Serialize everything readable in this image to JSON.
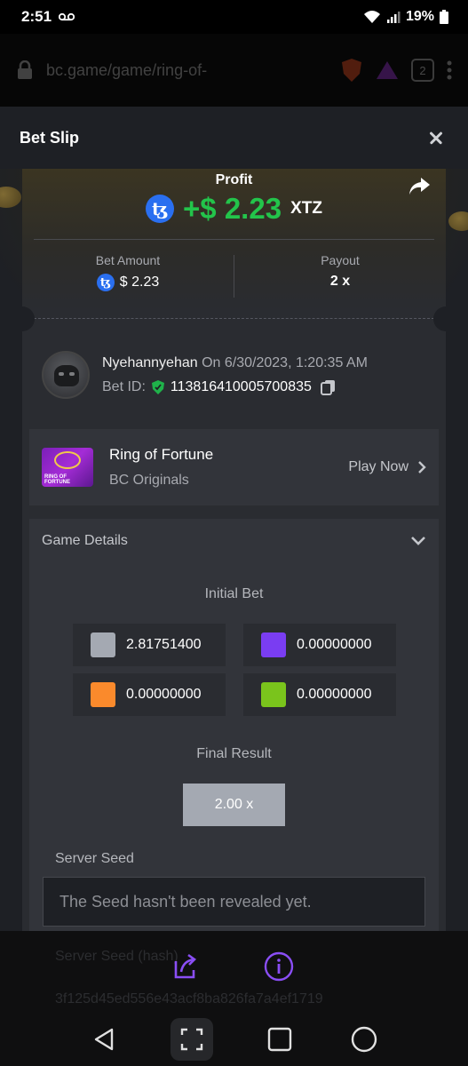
{
  "status_bar": {
    "time": "2:51",
    "battery": "19%"
  },
  "browser": {
    "url": "bc.game/game/ring-of-",
    "tab_count": "2"
  },
  "sheet": {
    "title": "Bet Slip",
    "profit_label": "Profit",
    "profit_value": "+$ 2.23",
    "profit_currency": "XTZ",
    "bet_amount_label": "Bet Amount",
    "bet_amount_value": "$ 2.23",
    "payout_label": "Payout",
    "payout_value": "2 x",
    "user": {
      "name": "Nyehannyehan",
      "date_text": "On 6/30/2023, 1:20:35 AM",
      "bet_id_label": "Bet ID:",
      "bet_id": "113816410005700835"
    },
    "game": {
      "name": "Ring of Fortune",
      "provider": "BC Originals",
      "play_now": "Play Now",
      "thumb_text": "RING OF FORTUNE",
      "thumb_badge": "BC.GAME"
    },
    "details": {
      "title": "Game Details",
      "initial_bet_label": "Initial Bet",
      "bets": [
        {
          "color": "#a4a9b2",
          "value": "2.81751400"
        },
        {
          "color": "#7a3df2",
          "value": "0.00000000"
        },
        {
          "color": "#fa8a2c",
          "value": "0.00000000"
        },
        {
          "color": "#7ac41c",
          "value": "0.00000000"
        }
      ],
      "final_result_label": "Final Result",
      "final_result_value": "2.00 x",
      "server_seed_label": "Server Seed",
      "server_seed_value": "The Seed hasn't been revealed yet."
    }
  },
  "bottom_overlay": {
    "bg_label": "Server Seed (hash)",
    "bg_hash": "3f125d45ed556e43acf8ba826fa7a4ef1719"
  },
  "colors": {
    "accent_purple": "#7a3df2",
    "profit_green": "#23c44b",
    "xtz_blue": "#2a6ff0"
  }
}
